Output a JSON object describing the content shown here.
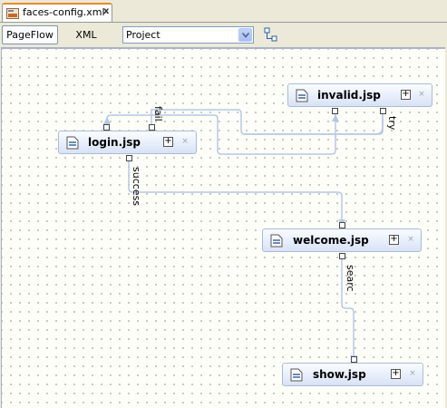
{
  "editor_tab": {
    "title": "faces-config.xml",
    "close_glyph": "x",
    "icon": "jsf-file-icon"
  },
  "toolbar": {
    "pageflow_label": "PageFlow",
    "xml_label": "XML",
    "scope_select": {
      "selected": "Project"
    },
    "layout_icon": "layout-icon"
  },
  "nodes": {
    "login": "login.jsp",
    "invalid": "invalid.jsp",
    "welcome": "welcome.jsp",
    "show": "show.jsp"
  },
  "edges": {
    "fail": "fail",
    "try": "try",
    "success": "success",
    "search": "searc"
  },
  "colors": {
    "edge": "#b5c7e4",
    "node_border": "#a9bcd6",
    "tab_accent": "#e68b2c"
  }
}
